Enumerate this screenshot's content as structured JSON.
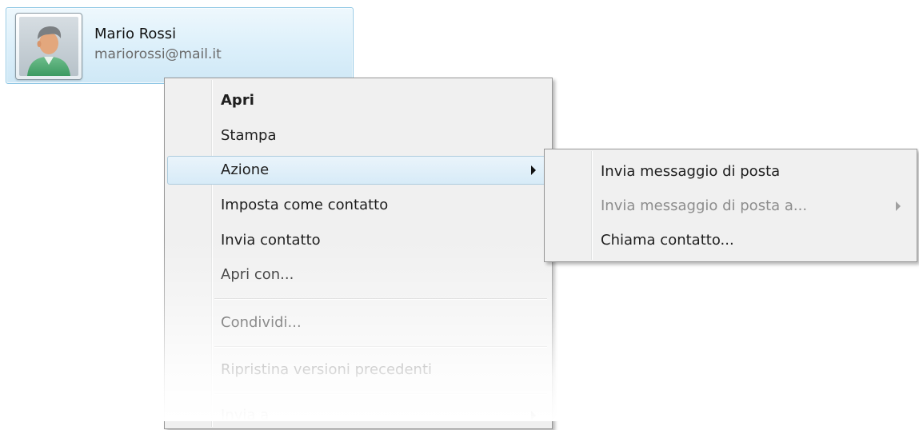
{
  "contact": {
    "name": "Mario Rossi",
    "email": "mariorossi@mail.it",
    "avatar_icon": "user-avatar-icon"
  },
  "context_menu": {
    "items": [
      {
        "label": "Apri",
        "bold": true,
        "disabled": false
      },
      {
        "label": "Stampa",
        "disabled": false
      },
      {
        "label": "Azione",
        "disabled": false,
        "submenu": true,
        "highlighted": true
      },
      {
        "label": "Imposta come contatto",
        "disabled": false
      },
      {
        "label": "Invia contatto",
        "disabled": false
      },
      {
        "label": "Apri con...",
        "disabled": false
      },
      {
        "label": "Condividi...",
        "disabled": false
      },
      {
        "label": "Ripristina versioni precedenti",
        "disabled": false
      },
      {
        "label": "Invia a",
        "disabled": false,
        "submenu": true
      }
    ]
  },
  "submenu": {
    "items": [
      {
        "label": "Invia messaggio di posta",
        "disabled": false
      },
      {
        "label": "Invia messaggio di posta a...",
        "disabled": true,
        "submenu": true
      },
      {
        "label": "Chiama contatto...",
        "disabled": false
      }
    ]
  },
  "colors": {
    "menu_background": "#f0f0f0",
    "highlight_border": "#aeccde",
    "card_border": "#8fc7e4",
    "disabled_text": "#8d8d8d"
  }
}
